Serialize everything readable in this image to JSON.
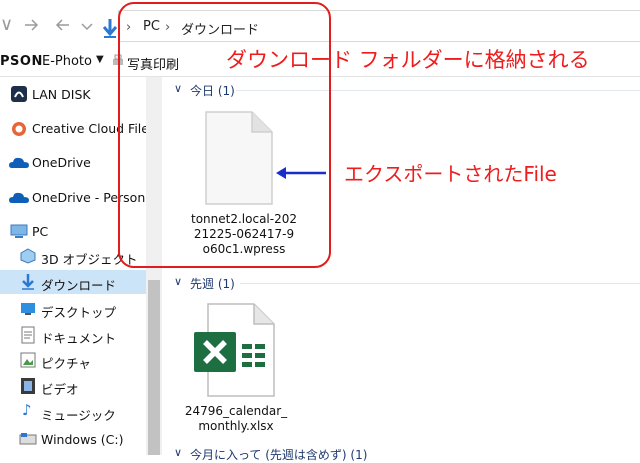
{
  "address_bar": {
    "crumbs": [
      "PC",
      "ダウンロード"
    ]
  },
  "toolbar": {
    "brand_prefix": "PSON",
    "app_label": "E-Photo",
    "print_label": "写真印刷"
  },
  "sidebar": {
    "items": [
      {
        "label": "LAN DISK"
      },
      {
        "label": "Creative Cloud Files"
      },
      {
        "label": "OneDrive"
      },
      {
        "label": "OneDrive - Personal"
      },
      {
        "label": "PC"
      },
      {
        "label": "3D オブジェクト"
      },
      {
        "label": "ダウンロード",
        "selected": true
      },
      {
        "label": "デスクトップ"
      },
      {
        "label": "ドキュメント"
      },
      {
        "label": "ピクチャ"
      },
      {
        "label": "ビデオ"
      },
      {
        "label": "ミュージック"
      },
      {
        "label": "Windows (C:)"
      }
    ]
  },
  "groups": [
    {
      "header": "今日 (1)",
      "files": [
        {
          "name_lines": [
            "tonnet2.local-202",
            "21225-062417-9",
            "o60c1.wpress"
          ]
        }
      ]
    },
    {
      "header": "先週 (1)",
      "files": [
        {
          "name_lines": [
            "24796_calendar_",
            "monthly.xlsx"
          ]
        }
      ]
    },
    {
      "header": "今月に入って (先週は含めず) (1)"
    }
  ],
  "annotations": {
    "folder_note": "ダウンロード  フォルダーに格納される",
    "file_note": "エクスポートされたFile"
  },
  "colors": {
    "annotation": "#ee1c1c",
    "selection": "#cce4f7",
    "excel_green": "#1d6f42",
    "arrow_blue": "#1a2fc9"
  }
}
